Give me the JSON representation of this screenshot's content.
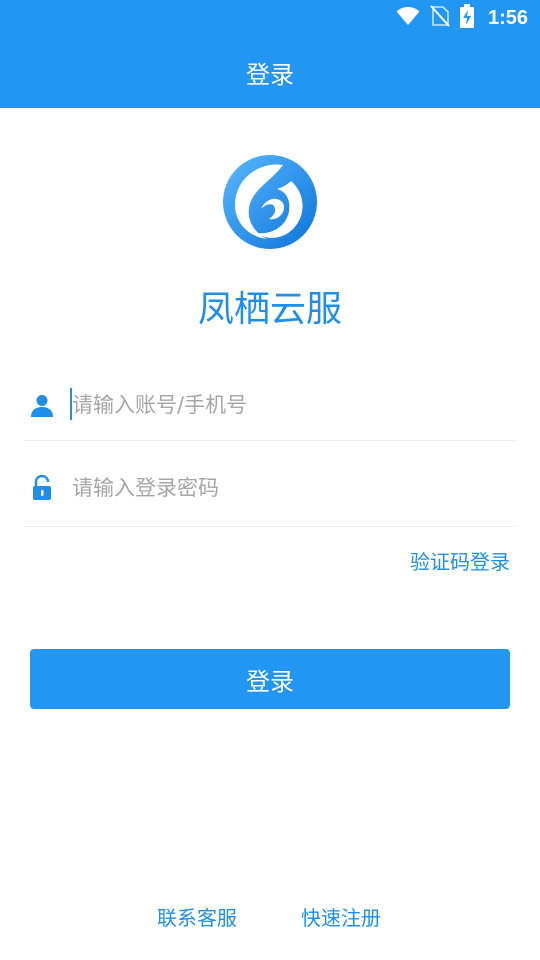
{
  "status_bar": {
    "time": "1:56",
    "icons": [
      "wifi-icon",
      "no-sim-icon",
      "battery-charging-icon"
    ]
  },
  "header": {
    "title": "登录"
  },
  "app": {
    "logo": "phoenix-logo-icon",
    "name": "凤栖云服"
  },
  "form": {
    "username": {
      "icon": "user-icon",
      "placeholder": "请输入账号/手机号",
      "value": ""
    },
    "password": {
      "icon": "lock-icon",
      "placeholder": "请输入登录密码",
      "value": ""
    },
    "sms_login_label": "验证码登录",
    "submit_label": "登录"
  },
  "footer": {
    "contact_label": "联系客服",
    "register_label": "快速注册"
  },
  "colors": {
    "primary": "#2196f3",
    "accent_text": "#1e8fe8",
    "placeholder": "#a5a5a5",
    "divider": "#ececec"
  }
}
